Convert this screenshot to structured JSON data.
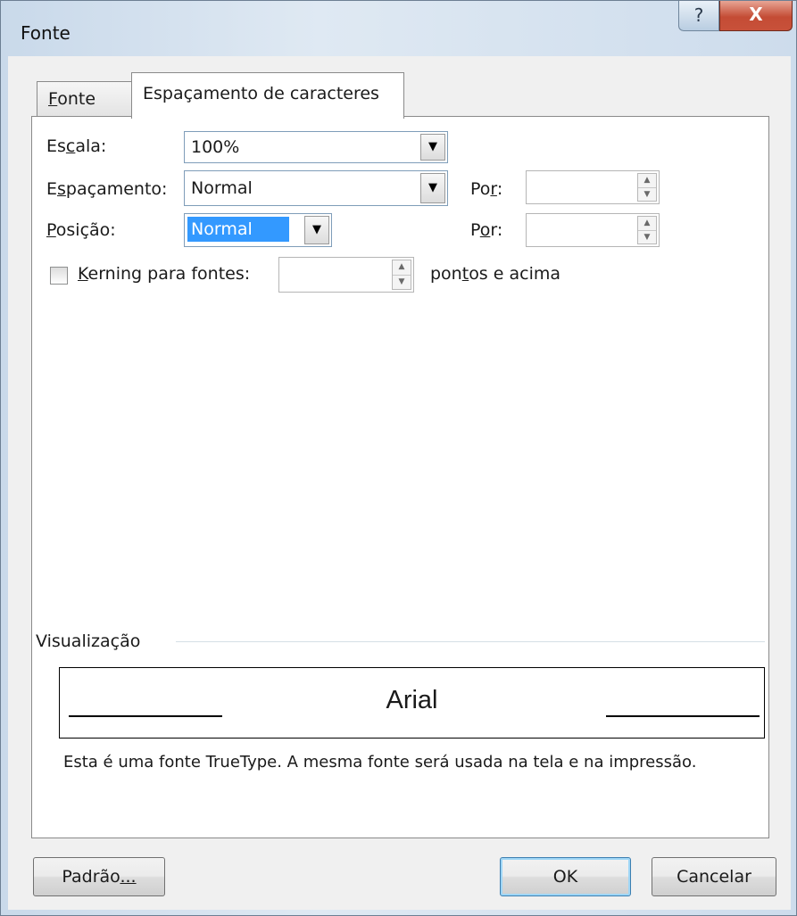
{
  "window": {
    "title": "Fonte",
    "help_icon": "?",
    "close_icon": "X"
  },
  "tabs": [
    {
      "label": "Fonte",
      "mnemonic": "F",
      "rest": "onte",
      "active": false
    },
    {
      "label": "Espaçamento de caracteres",
      "active": true
    }
  ],
  "fields": {
    "escala": {
      "label_pre": "Es",
      "label_mn": "c",
      "label_post": "ala:",
      "value": "100%"
    },
    "espacamento": {
      "label_pre": "E",
      "label_mn": "s",
      "label_post": "paçamento:",
      "value": "Normal",
      "por_pre": "Po",
      "por_mn": "r",
      "por_post": ":",
      "por_value": ""
    },
    "posicao": {
      "label_pre": "",
      "label_mn": "P",
      "label_post": "osição:",
      "value": "Normal",
      "por_pre": "P",
      "por_mn": "o",
      "por_post": "r:",
      "por_value": ""
    },
    "kerning": {
      "label_pre": "",
      "label_mn": "K",
      "label_post": "erning para fontes:",
      "value": "",
      "checked": false,
      "suffix_pre": "pon",
      "suffix_mn": "t",
      "suffix_post": "os e acima"
    }
  },
  "preview": {
    "group_label": "Visualização",
    "sample_text": "Arial",
    "note": "Esta é uma fonte TrueType. A mesma fonte será usada na tela e na impressão."
  },
  "buttons": {
    "default_pre": "Padrão",
    "default_mn": "...",
    "ok": "OK",
    "cancel": "Cancelar"
  }
}
